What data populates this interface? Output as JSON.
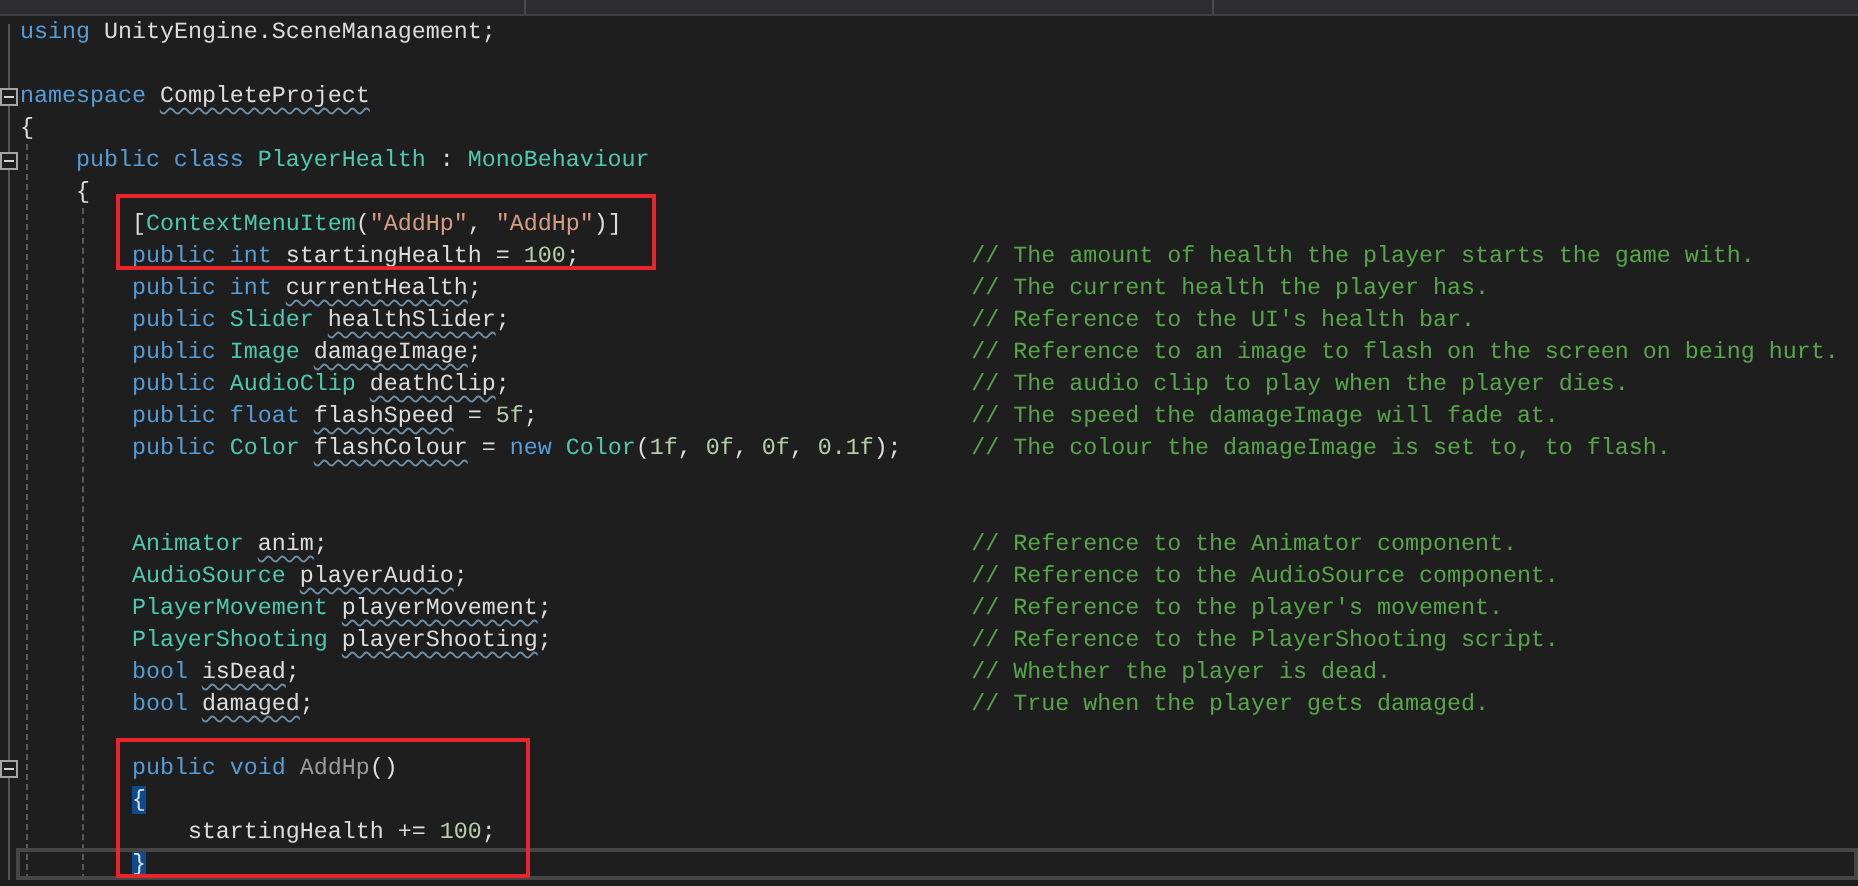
{
  "editor": {
    "lines": [
      {
        "kind": "code",
        "fold": false,
        "current": false,
        "tokens": [
          {
            "kind": "keyword",
            "text": "using"
          },
          {
            "kind": "plain",
            "text": " UnityEngine.SceneManagement;"
          }
        ]
      },
      {
        "kind": "blank"
      },
      {
        "kind": "code",
        "fold": true,
        "current": false,
        "tokens": [
          {
            "kind": "keyword",
            "text": "namespace "
          },
          {
            "kind": "warned",
            "text": "CompleteProject"
          }
        ]
      },
      {
        "kind": "code",
        "fold": false,
        "current": false,
        "tokens": [
          {
            "kind": "plain",
            "text": "{"
          }
        ],
        "children": [
          {
            "kind": "code",
            "fold": true,
            "current": false,
            "tokens": [
              {
                "kind": "keyword",
                "text": "public class "
              },
              {
                "kind": "type",
                "text": "PlayerHealth"
              },
              {
                "kind": "plain",
                "text": " : "
              },
              {
                "kind": "type",
                "text": "MonoBehaviour"
              }
            ]
          },
          {
            "kind": "code",
            "fold": false,
            "current": false,
            "tokens": [
              {
                "kind": "plain",
                "text": "{"
              }
            ],
            "children": [
              {
                "kind": "group",
                "boxed": true,
                "lines": [
                  {
                    "kind": "code",
                    "fold": false,
                    "current": false,
                    "tokens": [
                      {
                        "kind": "plain",
                        "text": "["
                      },
                      {
                        "kind": "type",
                        "text": "ContextMenuItem"
                      },
                      {
                        "kind": "plain",
                        "text": "("
                      },
                      {
                        "kind": "string",
                        "text": "\"AddHp\""
                      },
                      {
                        "kind": "plain",
                        "text": ", "
                      },
                      {
                        "kind": "string",
                        "text": "\"AddHp\""
                      },
                      {
                        "kind": "plain",
                        "text": ")]"
                      }
                    ]
                  },
                  {
                    "kind": "code",
                    "fold": false,
                    "current": false,
                    "tokens": [
                      {
                        "kind": "keyword",
                        "text": "public int"
                      },
                      {
                        "kind": "plain",
                        "text": " startingHealth = "
                      },
                      {
                        "kind": "number",
                        "text": "100"
                      },
                      {
                        "kind": "plain",
                        "text": ";"
                      }
                    ],
                    "comment": "// The amount of health the player starts the game with."
                  }
                ]
              },
              {
                "kind": "code",
                "fold": false,
                "current": false,
                "tokens": [
                  {
                    "kind": "keyword",
                    "text": "public int "
                  },
                  {
                    "kind": "warned",
                    "text": "currentHealth"
                  },
                  {
                    "kind": "plain",
                    "text": ";"
                  }
                ],
                "comment": "// The current health the player has."
              },
              {
                "kind": "code",
                "fold": false,
                "current": false,
                "tokens": [
                  {
                    "kind": "keyword",
                    "text": "public "
                  },
                  {
                    "kind": "type",
                    "text": "Slider "
                  },
                  {
                    "kind": "warned",
                    "text": "healthSlider"
                  },
                  {
                    "kind": "plain",
                    "text": ";"
                  }
                ],
                "comment": "// Reference to the UI's health bar."
              },
              {
                "kind": "code",
                "fold": false,
                "current": false,
                "tokens": [
                  {
                    "kind": "keyword",
                    "text": "public "
                  },
                  {
                    "kind": "type",
                    "text": "Image "
                  },
                  {
                    "kind": "warned",
                    "text": "damageImage"
                  },
                  {
                    "kind": "plain",
                    "text": ";"
                  }
                ],
                "comment": "// Reference to an image to flash on the screen on being hurt."
              },
              {
                "kind": "code",
                "fold": false,
                "current": false,
                "tokens": [
                  {
                    "kind": "keyword",
                    "text": "public "
                  },
                  {
                    "kind": "type",
                    "text": "AudioClip "
                  },
                  {
                    "kind": "warned",
                    "text": "deathClip"
                  },
                  {
                    "kind": "plain",
                    "text": ";"
                  }
                ],
                "comment": "// The audio clip to play when the player dies."
              },
              {
                "kind": "code",
                "fold": false,
                "current": false,
                "tokens": [
                  {
                    "kind": "keyword",
                    "text": "public float "
                  },
                  {
                    "kind": "warned",
                    "text": "flashSpeed"
                  },
                  {
                    "kind": "plain",
                    "text": " = "
                  },
                  {
                    "kind": "number",
                    "text": "5f"
                  },
                  {
                    "kind": "plain",
                    "text": ";"
                  }
                ],
                "comment": "// The speed the damageImage will fade at."
              },
              {
                "kind": "code",
                "fold": false,
                "current": false,
                "tokens": [
                  {
                    "kind": "keyword",
                    "text": "public "
                  },
                  {
                    "kind": "type",
                    "text": "Color "
                  },
                  {
                    "kind": "warned",
                    "text": "flashColour"
                  },
                  {
                    "kind": "plain",
                    "text": " = "
                  },
                  {
                    "kind": "keyword",
                    "text": "new "
                  },
                  {
                    "kind": "type",
                    "text": "Color"
                  },
                  {
                    "kind": "plain",
                    "text": "("
                  },
                  {
                    "kind": "number",
                    "text": "1f"
                  },
                  {
                    "kind": "plain",
                    "text": ", "
                  },
                  {
                    "kind": "number",
                    "text": "0f"
                  },
                  {
                    "kind": "plain",
                    "text": ", "
                  },
                  {
                    "kind": "number",
                    "text": "0f"
                  },
                  {
                    "kind": "plain",
                    "text": ", "
                  },
                  {
                    "kind": "number",
                    "text": "0.1f"
                  },
                  {
                    "kind": "plain",
                    "text": ");"
                  }
                ],
                "comment": "// The colour the damageImage is set to, to flash."
              },
              {
                "kind": "blank"
              },
              {
                "kind": "blank"
              },
              {
                "kind": "code",
                "fold": false,
                "current": false,
                "tokens": [
                  {
                    "kind": "type",
                    "text": "Animator "
                  },
                  {
                    "kind": "warned",
                    "text": "anim"
                  },
                  {
                    "kind": "plain",
                    "text": ";"
                  }
                ],
                "comment": "// Reference to the Animator component."
              },
              {
                "kind": "code",
                "fold": false,
                "current": false,
                "tokens": [
                  {
                    "kind": "type",
                    "text": "AudioSource "
                  },
                  {
                    "kind": "warned",
                    "text": "playerAudio"
                  },
                  {
                    "kind": "plain",
                    "text": ";"
                  }
                ],
                "comment": "// Reference to the AudioSource component."
              },
              {
                "kind": "code",
                "fold": false,
                "current": false,
                "tokens": [
                  {
                    "kind": "type",
                    "text": "PlayerMovement "
                  },
                  {
                    "kind": "warned",
                    "text": "playerMovement"
                  },
                  {
                    "kind": "plain",
                    "text": ";"
                  }
                ],
                "comment": "// Reference to the player's movement."
              },
              {
                "kind": "code",
                "fold": false,
                "current": false,
                "tokens": [
                  {
                    "kind": "type",
                    "text": "PlayerShooting "
                  },
                  {
                    "kind": "warned",
                    "text": "playerShooting"
                  },
                  {
                    "kind": "plain",
                    "text": ";"
                  }
                ],
                "comment": "// Reference to the PlayerShooting script."
              },
              {
                "kind": "code",
                "fold": false,
                "current": false,
                "tokens": [
                  {
                    "kind": "keyword",
                    "text": "bool "
                  },
                  {
                    "kind": "warned",
                    "text": "isDead"
                  },
                  {
                    "kind": "plain",
                    "text": ";"
                  }
                ],
                "comment": "// Whether the player is dead."
              },
              {
                "kind": "code",
                "fold": false,
                "current": false,
                "tokens": [
                  {
                    "kind": "keyword",
                    "text": "bool "
                  },
                  {
                    "kind": "warned",
                    "text": "damaged"
                  },
                  {
                    "kind": "plain",
                    "text": ";"
                  }
                ],
                "comment": "// True when the player gets damaged."
              },
              {
                "kind": "blank"
              },
              {
                "kind": "group",
                "boxed": true,
                "lines": [
                  {
                    "kind": "code",
                    "fold": true,
                    "current": false,
                    "tokens": [
                      {
                        "kind": "keyword",
                        "text": "public void "
                      },
                      {
                        "kind": "unused",
                        "text": "AddHp"
                      },
                      {
                        "kind": "plain",
                        "text": "()"
                      }
                    ]
                  },
                  {
                    "kind": "code",
                    "fold": false,
                    "current": false,
                    "tokens": [
                      {
                        "kind": "brace-match",
                        "text": "{"
                      }
                    ],
                    "children": [
                      {
                        "kind": "code",
                        "fold": false,
                        "current": false,
                        "tokens": [
                          {
                            "kind": "plain",
                            "text": "startingHealth += "
                          },
                          {
                            "kind": "number",
                            "text": "100"
                          },
                          {
                            "kind": "plain",
                            "text": ";"
                          }
                        ]
                      }
                    ]
                  },
                  {
                    "kind": "code",
                    "fold": false,
                    "current": true,
                    "tokens": [
                      {
                        "kind": "brace-match",
                        "text": "}"
                      }
                    ]
                  }
                ]
              }
            ]
          }
        ]
      }
    ]
  }
}
